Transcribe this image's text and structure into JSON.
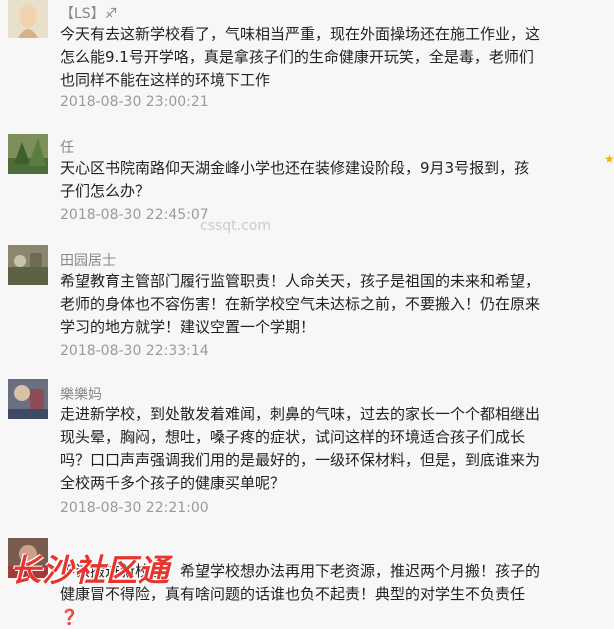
{
  "comments": [
    {
      "name": "【LS】♐",
      "text": "今天有去这新学校看了，气味相当严重，现在外面操场还在施工作业，这怎么能9.1号开学咯，真是拿孩子们的生命健康开玩笑，全是毒，老师们也同样不能在这样的环境下工作",
      "time": "2018-08-30 23:00:21"
    },
    {
      "name": "任",
      "text": "天心区书院南路仰天湖金峰小学也还在装修建设阶段，9月3号报到，孩子们怎么办？",
      "time": "2018-08-30 22:45:07"
    },
    {
      "name": "田园居士",
      "text": "希望教育主管部门履行监管职责！人命关天，孩子是祖国的未来和希望，老师的身体也不容伤害！在新学校空气未达标之前，不要搬入！仍在原来学习的地方就学！建议空置一个学期！",
      "time": "2018-08-30 22:33:14"
    },
    {
      "name": "樂樂妈",
      "text": "走进新学校，到处散发着难闻，刺鼻的气味，过去的家长一个个都相继出现头晕，胸闷，想吐，嗓子疼的症状，试问这样的环境适合孩子们成长吗？口口声声强调我们用的是最好的，一级环保材料，但是，到底谁来为全校两千多个孩子的健康买单呢？",
      "time": "2018-08-30 22:21:00"
    },
    {
      "name": "",
      "text": "不该搬进新校区！希望学校想办法再用下老资源，推迟两个月搬！孩子的健康冒不得险，真有啥问题的话谁也负不起责！典型的对学生不负责任",
      "time": ""
    }
  ],
  "watermark": "长沙社区通",
  "watermark2": "cssqt.com",
  "qmark": "❓",
  "star": "★"
}
